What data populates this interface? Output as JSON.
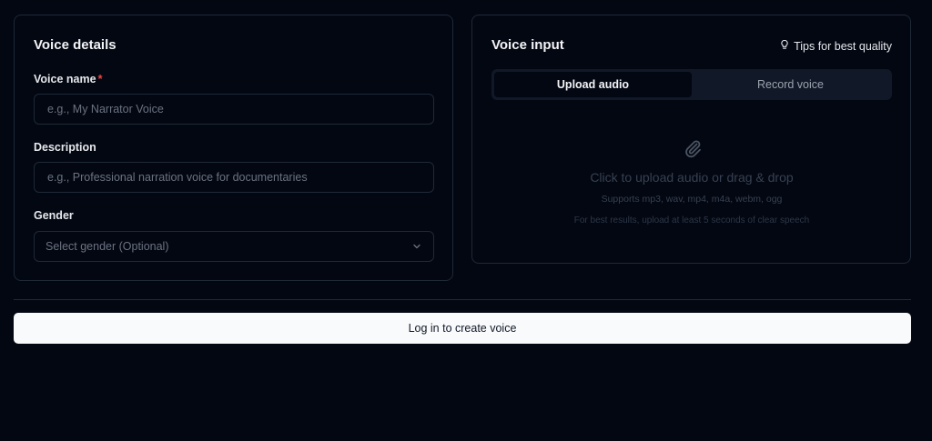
{
  "voice_details": {
    "title": "Voice details",
    "name_label": "Voice name",
    "required_marker": "*",
    "name_placeholder": "e.g., My Narrator Voice",
    "description_label": "Description",
    "description_placeholder": "e.g., Professional narration voice for documentaries",
    "gender_label": "Gender",
    "gender_placeholder": "Select gender (Optional)"
  },
  "voice_input": {
    "title": "Voice input",
    "tips_label": "Tips for best quality",
    "tabs": [
      {
        "label": "Upload audio",
        "active": true
      },
      {
        "label": "Record voice",
        "active": false
      }
    ],
    "dropzone": {
      "main_text": "Click to upload audio or drag & drop",
      "formats_text": "Supports mp3, wav, mp4, m4a, webm, ogg",
      "hint_text": "For best results, upload at least 5 seconds of clear speech"
    }
  },
  "submit_label": "Log in to create voice",
  "icons": {
    "tips": "lightbulb-icon",
    "upload": "paperclip-icon",
    "select": "chevron-down-icon"
  },
  "colors": {
    "background": "#030712",
    "border": "#1f2937",
    "required": "#ef4444",
    "button_bg": "#f9fafb"
  }
}
